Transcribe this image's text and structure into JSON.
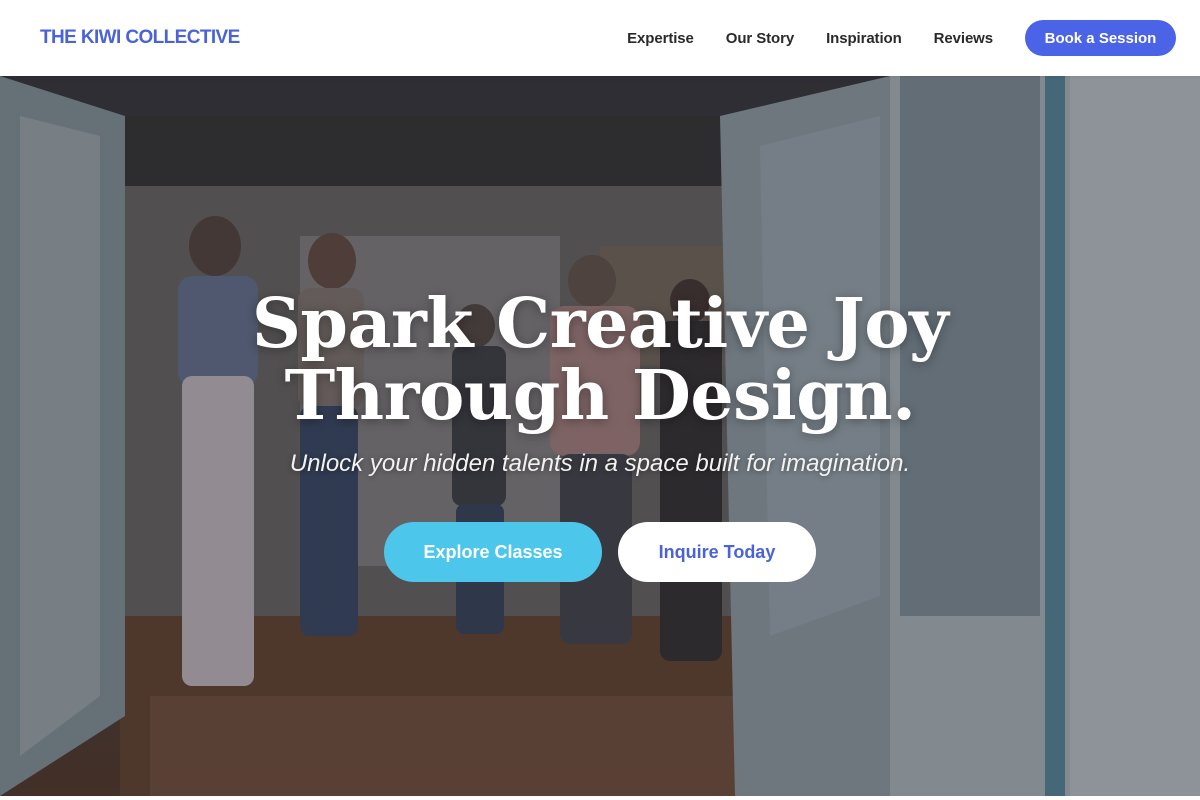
{
  "header": {
    "brand": "THE KIWI COLLECTIVE",
    "nav": [
      {
        "label": "Expertise"
      },
      {
        "label": "Our Story"
      },
      {
        "label": "Inspiration"
      },
      {
        "label": "Reviews"
      }
    ],
    "cta_label": "Book a Session"
  },
  "hero": {
    "headline_line1": "Spark Creative Joy",
    "headline_line2": "Through Design.",
    "subheadline": "Unlock your hidden talents in a space built for imagination.",
    "primary_button": "Explore Classes",
    "secondary_button": "Inquire Today"
  },
  "colors": {
    "brand": "#4b63d9",
    "cta": "#4a63e7",
    "primary_button": "#4dc6ec",
    "secondary_button_text": "#4b63d9"
  }
}
